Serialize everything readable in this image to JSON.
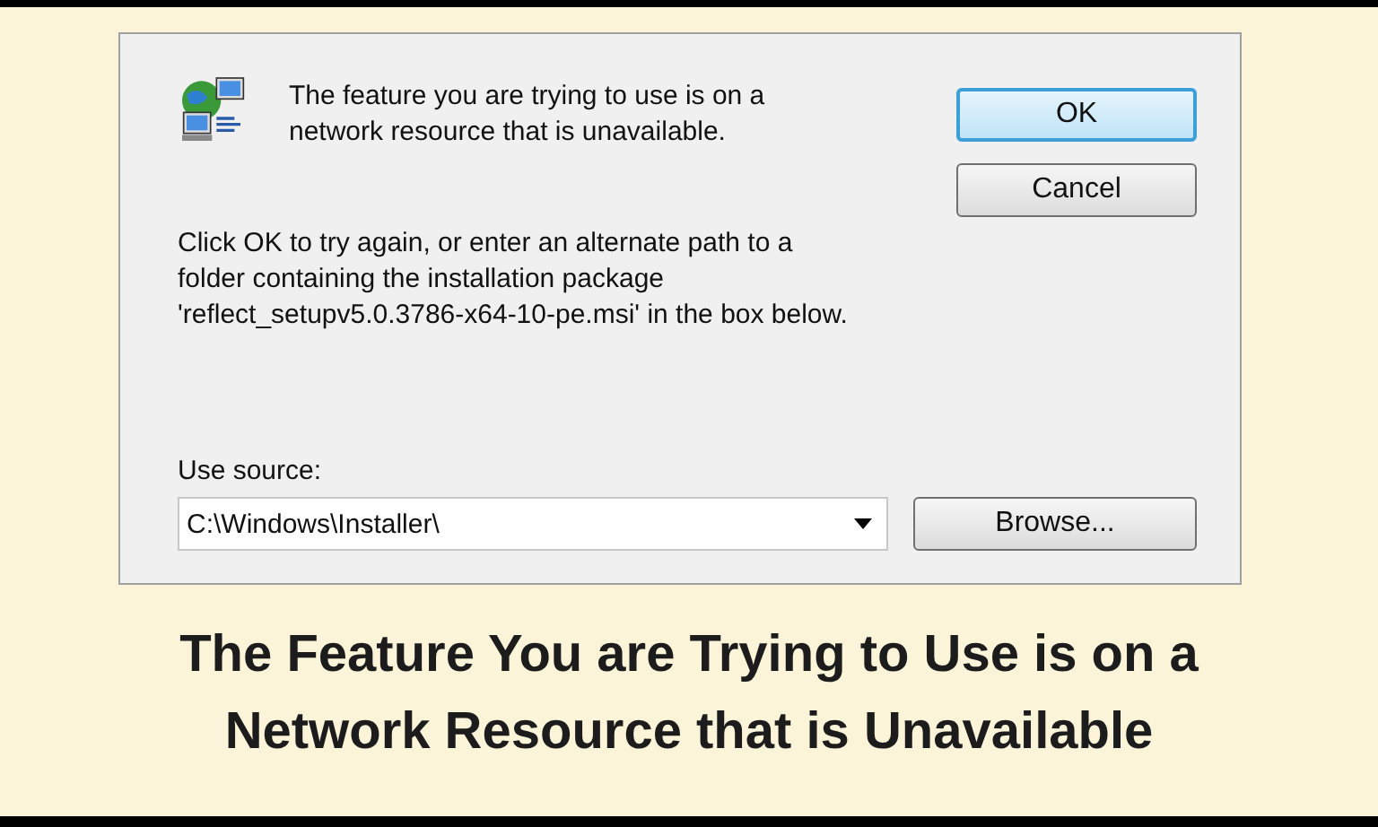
{
  "dialog": {
    "message": "The feature you are trying to use is on a network resource that is unavailable.",
    "instructions": "Click OK to try again, or enter an alternate path to a folder containing the installation package 'reflect_setupv5.0.3786-x64-10-pe.msi' in the box below.",
    "source_label": "Use source:",
    "source_value": "C:\\Windows\\Installer\\",
    "buttons": [
      {
        "label": "OK",
        "default": true
      },
      {
        "label": "Cancel",
        "default": false
      }
    ],
    "browse_button": "Browse..."
  },
  "caption": [
    "The Feature You are Trying to Use is on a",
    "Network Resource that is Unavailable"
  ]
}
